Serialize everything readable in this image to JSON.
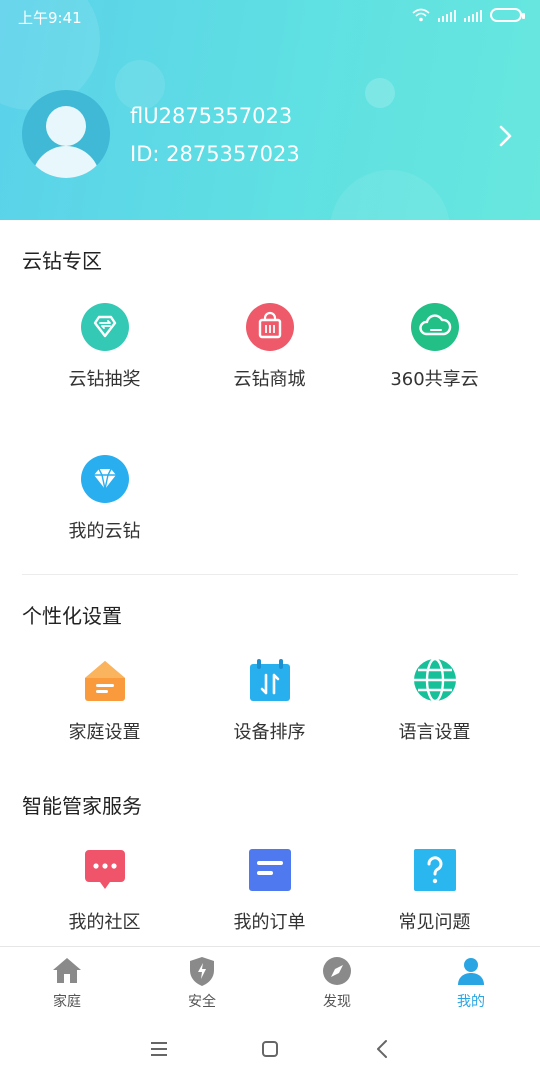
{
  "status_bar": {
    "time": "上午9:41"
  },
  "profile": {
    "name": "flU2875357023",
    "id_text": "ID: 2875357023"
  },
  "sections": {
    "cloud_drill": {
      "title": "云钻专区",
      "items": [
        {
          "label": "云钻抽奖",
          "icon": "lottery-icon",
          "color": "#34c9b5"
        },
        {
          "label": "云钻商城",
          "icon": "shopping-bag-icon",
          "color": "#ef5a6a"
        },
        {
          "label": "360共享云",
          "icon": "cloud-icon",
          "color": "#22bf86"
        },
        {
          "label": "我的云钻",
          "icon": "diamond-icon",
          "color": "#29aef0"
        }
      ]
    },
    "personalize": {
      "title": "个性化设置",
      "items": [
        {
          "label": "家庭设置",
          "icon": "home-settings-icon",
          "color": "#f99a3c"
        },
        {
          "label": "设备排序",
          "icon": "sort-icon",
          "color": "#28b0ee"
        },
        {
          "label": "语言设置",
          "icon": "globe-icon",
          "color": "#16c19a"
        }
      ]
    },
    "butler": {
      "title": "智能管家服务",
      "items": [
        {
          "label": "我的社区",
          "icon": "chat-bubble-icon",
          "color": "#f0546a"
        },
        {
          "label": "我的订单",
          "icon": "order-icon",
          "color": "#4e79ef"
        },
        {
          "label": "常见问题",
          "icon": "question-icon",
          "color": "#2ab6ee"
        }
      ]
    }
  },
  "tabbar": {
    "items": [
      {
        "label": "家庭",
        "icon": "home-icon"
      },
      {
        "label": "安全",
        "icon": "shield-icon"
      },
      {
        "label": "发现",
        "icon": "compass-icon"
      },
      {
        "label": "我的",
        "icon": "person-icon",
        "active": true
      }
    ]
  }
}
